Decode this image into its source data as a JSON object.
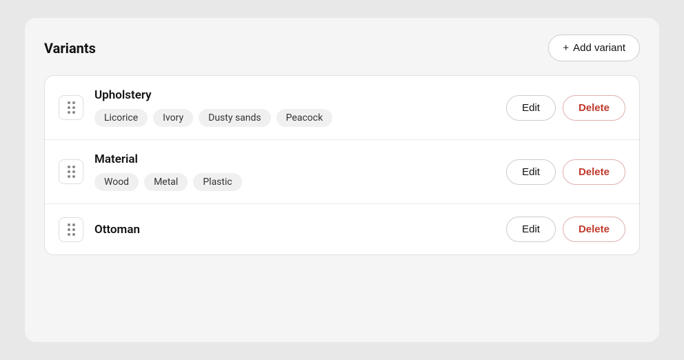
{
  "header": {
    "title": "Variants",
    "add_button_label": "Add variant",
    "plus_icon": "+"
  },
  "variants": [
    {
      "id": "upholstery",
      "name": "Upholstery",
      "tags": [
        "Licorice",
        "Ivory",
        "Dusty sands",
        "Peacock"
      ],
      "edit_label": "Edit",
      "delete_label": "Delete"
    },
    {
      "id": "material",
      "name": "Material",
      "tags": [
        "Wood",
        "Metal",
        "Plastic"
      ],
      "edit_label": "Edit",
      "delete_label": "Delete"
    },
    {
      "id": "ottoman",
      "name": "Ottoman",
      "tags": [],
      "edit_label": "Edit",
      "delete_label": "Delete"
    }
  ]
}
